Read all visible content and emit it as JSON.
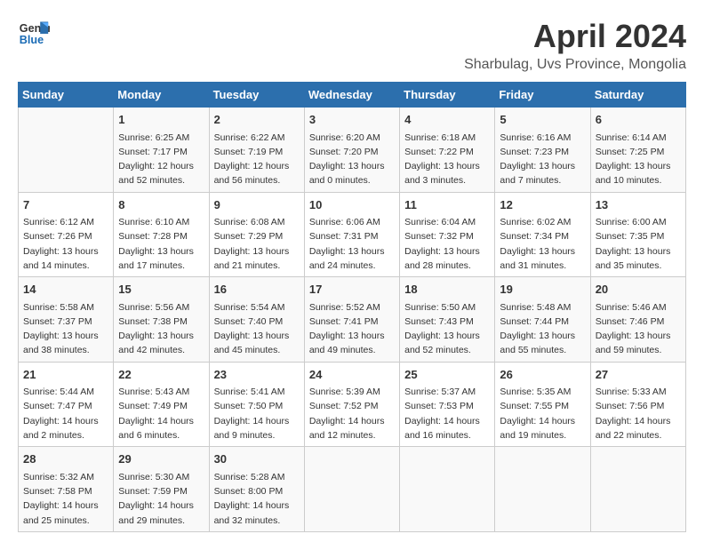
{
  "header": {
    "logo_line1": "General",
    "logo_line2": "Blue",
    "month_year": "April 2024",
    "location": "Sharbulag, Uvs Province, Mongolia"
  },
  "days_of_week": [
    "Sunday",
    "Monday",
    "Tuesday",
    "Wednesday",
    "Thursday",
    "Friday",
    "Saturday"
  ],
  "weeks": [
    [
      {
        "day": "",
        "content": ""
      },
      {
        "day": "1",
        "content": "Sunrise: 6:25 AM\nSunset: 7:17 PM\nDaylight: 12 hours\nand 52 minutes."
      },
      {
        "day": "2",
        "content": "Sunrise: 6:22 AM\nSunset: 7:19 PM\nDaylight: 12 hours\nand 56 minutes."
      },
      {
        "day": "3",
        "content": "Sunrise: 6:20 AM\nSunset: 7:20 PM\nDaylight: 13 hours\nand 0 minutes."
      },
      {
        "day": "4",
        "content": "Sunrise: 6:18 AM\nSunset: 7:22 PM\nDaylight: 13 hours\nand 3 minutes."
      },
      {
        "day": "5",
        "content": "Sunrise: 6:16 AM\nSunset: 7:23 PM\nDaylight: 13 hours\nand 7 minutes."
      },
      {
        "day": "6",
        "content": "Sunrise: 6:14 AM\nSunset: 7:25 PM\nDaylight: 13 hours\nand 10 minutes."
      }
    ],
    [
      {
        "day": "7",
        "content": "Sunrise: 6:12 AM\nSunset: 7:26 PM\nDaylight: 13 hours\nand 14 minutes."
      },
      {
        "day": "8",
        "content": "Sunrise: 6:10 AM\nSunset: 7:28 PM\nDaylight: 13 hours\nand 17 minutes."
      },
      {
        "day": "9",
        "content": "Sunrise: 6:08 AM\nSunset: 7:29 PM\nDaylight: 13 hours\nand 21 minutes."
      },
      {
        "day": "10",
        "content": "Sunrise: 6:06 AM\nSunset: 7:31 PM\nDaylight: 13 hours\nand 24 minutes."
      },
      {
        "day": "11",
        "content": "Sunrise: 6:04 AM\nSunset: 7:32 PM\nDaylight: 13 hours\nand 28 minutes."
      },
      {
        "day": "12",
        "content": "Sunrise: 6:02 AM\nSunset: 7:34 PM\nDaylight: 13 hours\nand 31 minutes."
      },
      {
        "day": "13",
        "content": "Sunrise: 6:00 AM\nSunset: 7:35 PM\nDaylight: 13 hours\nand 35 minutes."
      }
    ],
    [
      {
        "day": "14",
        "content": "Sunrise: 5:58 AM\nSunset: 7:37 PM\nDaylight: 13 hours\nand 38 minutes."
      },
      {
        "day": "15",
        "content": "Sunrise: 5:56 AM\nSunset: 7:38 PM\nDaylight: 13 hours\nand 42 minutes."
      },
      {
        "day": "16",
        "content": "Sunrise: 5:54 AM\nSunset: 7:40 PM\nDaylight: 13 hours\nand 45 minutes."
      },
      {
        "day": "17",
        "content": "Sunrise: 5:52 AM\nSunset: 7:41 PM\nDaylight: 13 hours\nand 49 minutes."
      },
      {
        "day": "18",
        "content": "Sunrise: 5:50 AM\nSunset: 7:43 PM\nDaylight: 13 hours\nand 52 minutes."
      },
      {
        "day": "19",
        "content": "Sunrise: 5:48 AM\nSunset: 7:44 PM\nDaylight: 13 hours\nand 55 minutes."
      },
      {
        "day": "20",
        "content": "Sunrise: 5:46 AM\nSunset: 7:46 PM\nDaylight: 13 hours\nand 59 minutes."
      }
    ],
    [
      {
        "day": "21",
        "content": "Sunrise: 5:44 AM\nSunset: 7:47 PM\nDaylight: 14 hours\nand 2 minutes."
      },
      {
        "day": "22",
        "content": "Sunrise: 5:43 AM\nSunset: 7:49 PM\nDaylight: 14 hours\nand 6 minutes."
      },
      {
        "day": "23",
        "content": "Sunrise: 5:41 AM\nSunset: 7:50 PM\nDaylight: 14 hours\nand 9 minutes."
      },
      {
        "day": "24",
        "content": "Sunrise: 5:39 AM\nSunset: 7:52 PM\nDaylight: 14 hours\nand 12 minutes."
      },
      {
        "day": "25",
        "content": "Sunrise: 5:37 AM\nSunset: 7:53 PM\nDaylight: 14 hours\nand 16 minutes."
      },
      {
        "day": "26",
        "content": "Sunrise: 5:35 AM\nSunset: 7:55 PM\nDaylight: 14 hours\nand 19 minutes."
      },
      {
        "day": "27",
        "content": "Sunrise: 5:33 AM\nSunset: 7:56 PM\nDaylight: 14 hours\nand 22 minutes."
      }
    ],
    [
      {
        "day": "28",
        "content": "Sunrise: 5:32 AM\nSunset: 7:58 PM\nDaylight: 14 hours\nand 25 minutes."
      },
      {
        "day": "29",
        "content": "Sunrise: 5:30 AM\nSunset: 7:59 PM\nDaylight: 14 hours\nand 29 minutes."
      },
      {
        "day": "30",
        "content": "Sunrise: 5:28 AM\nSunset: 8:00 PM\nDaylight: 14 hours\nand 32 minutes."
      },
      {
        "day": "",
        "content": ""
      },
      {
        "day": "",
        "content": ""
      },
      {
        "day": "",
        "content": ""
      },
      {
        "day": "",
        "content": ""
      }
    ]
  ]
}
